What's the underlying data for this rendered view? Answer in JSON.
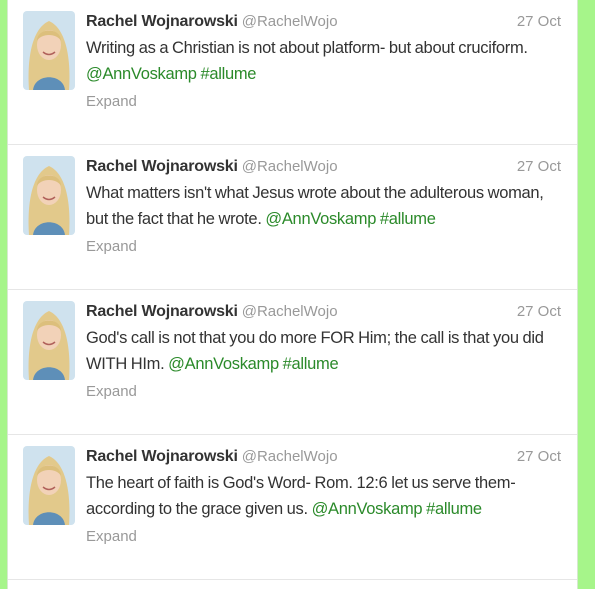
{
  "colors": {
    "page_background": "#a6f58a",
    "link": "#2b8a2a",
    "name": "#333333",
    "meta": "#999999"
  },
  "tweets": [
    {
      "fullname": "Rachel Wojnarowski",
      "username": "@RachelWojo",
      "timestamp": "27 Oct",
      "text_before": "Writing as a Christian is not about platform- but about cruciform.",
      "mention": "@AnnVoskamp",
      "hashtag": "#allume",
      "expand": "Expand"
    },
    {
      "fullname": "Rachel Wojnarowski",
      "username": "@RachelWojo",
      "timestamp": "27 Oct",
      "text_before": "What matters isn't what Jesus wrote about the adulterous woman, but the fact that he wrote.",
      "mention": "@AnnVoskamp",
      "hashtag": "#allume",
      "expand": "Expand"
    },
    {
      "fullname": "Rachel Wojnarowski",
      "username": "@RachelWojo",
      "timestamp": "27 Oct",
      "text_before": "God's call is not that you do more FOR Him; the call is that you did WITH HIm.",
      "mention": "@AnnVoskamp",
      "hashtag": "#allume",
      "expand": "Expand"
    },
    {
      "fullname": "Rachel Wojnarowski",
      "username": "@RachelWojo",
      "timestamp": "27 Oct",
      "text_before": "The heart of faith is God's Word- Rom. 12:6 let us serve them- according to the grace given us.",
      "mention": "@AnnVoskamp",
      "hashtag": "#allume",
      "expand": "Expand"
    }
  ]
}
